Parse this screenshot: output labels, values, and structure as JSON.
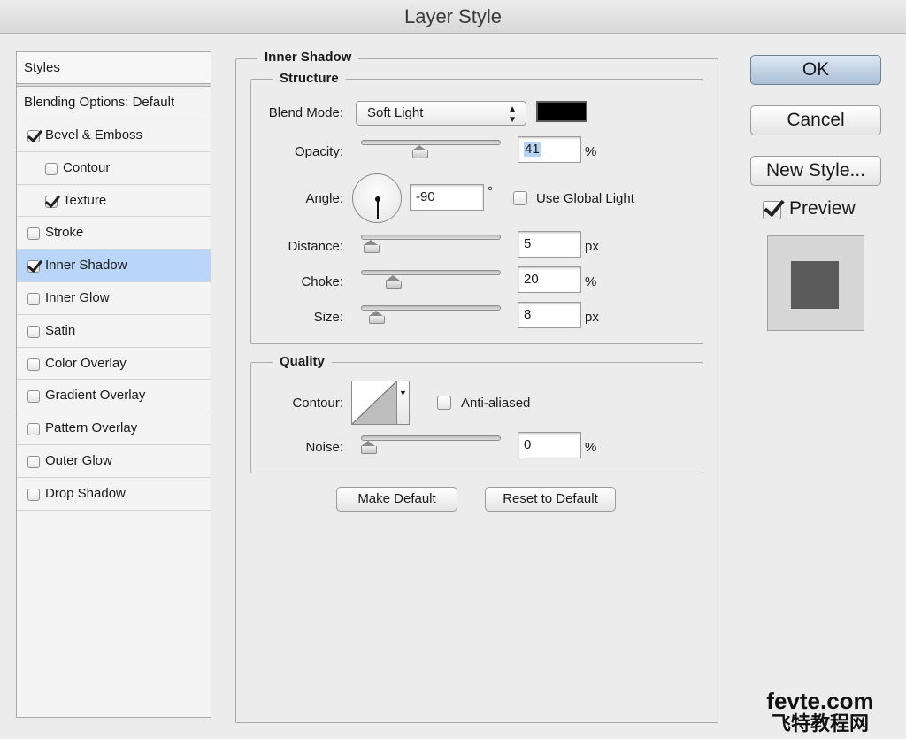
{
  "window": {
    "title": "Layer Style"
  },
  "styles_panel": {
    "header": "Styles",
    "items": [
      {
        "label": "Blending Options: Default",
        "checkbox": false,
        "checked": false,
        "sub": false,
        "selected": false
      },
      {
        "label": "Bevel & Emboss",
        "checkbox": true,
        "checked": true,
        "sub": false,
        "selected": false
      },
      {
        "label": "Contour",
        "checkbox": true,
        "checked": false,
        "sub": true,
        "selected": false
      },
      {
        "label": "Texture",
        "checkbox": true,
        "checked": true,
        "sub": true,
        "selected": false
      },
      {
        "label": "Stroke",
        "checkbox": true,
        "checked": false,
        "sub": false,
        "selected": false
      },
      {
        "label": "Inner Shadow",
        "checkbox": true,
        "checked": true,
        "sub": false,
        "selected": true
      },
      {
        "label": "Inner Glow",
        "checkbox": true,
        "checked": false,
        "sub": false,
        "selected": false
      },
      {
        "label": "Satin",
        "checkbox": true,
        "checked": false,
        "sub": false,
        "selected": false
      },
      {
        "label": "Color Overlay",
        "checkbox": true,
        "checked": false,
        "sub": false,
        "selected": false
      },
      {
        "label": "Gradient Overlay",
        "checkbox": true,
        "checked": false,
        "sub": false,
        "selected": false
      },
      {
        "label": "Pattern Overlay",
        "checkbox": true,
        "checked": false,
        "sub": false,
        "selected": false
      },
      {
        "label": "Outer Glow",
        "checkbox": true,
        "checked": false,
        "sub": false,
        "selected": false
      },
      {
        "label": "Drop Shadow",
        "checkbox": true,
        "checked": false,
        "sub": false,
        "selected": false
      }
    ]
  },
  "inner_shadow": {
    "title": "Inner Shadow",
    "structure": {
      "title": "Structure",
      "blend_mode": {
        "label": "Blend Mode:",
        "value": "Soft Light",
        "color": "#000000"
      },
      "opacity": {
        "label": "Opacity:",
        "value": "41",
        "unit": "%",
        "fraction": 0.41
      },
      "angle": {
        "label": "Angle:",
        "value": "-90",
        "unit": "°",
        "use_global_light": {
          "label": "Use Global Light",
          "checked": false
        }
      },
      "distance": {
        "label": "Distance:",
        "value": "5",
        "unit": "px",
        "fraction": 0.02
      },
      "choke": {
        "label": "Choke:",
        "value": "20",
        "unit": "%",
        "fraction": 0.2
      },
      "size": {
        "label": "Size:",
        "value": "8",
        "unit": "px",
        "fraction": 0.06
      }
    },
    "quality": {
      "title": "Quality",
      "contour": {
        "label": "Contour:",
        "anti_aliased": {
          "label": "Anti-aliased",
          "checked": false
        }
      },
      "noise": {
        "label": "Noise:",
        "value": "0",
        "unit": "%",
        "fraction": 0.0
      }
    },
    "make_default_label": "Make Default",
    "reset_default_label": "Reset to Default"
  },
  "actions": {
    "ok_label": "OK",
    "cancel_label": "Cancel",
    "new_style_label": "New Style...",
    "preview_label": "Preview",
    "preview_checked": true
  },
  "watermark": {
    "line1": "fevte.com",
    "line2": "飞特教程网"
  }
}
